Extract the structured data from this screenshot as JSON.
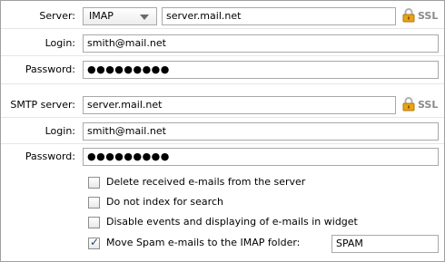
{
  "imap": {
    "server_label": "Server:",
    "protocol": "IMAP",
    "server_value": "server.mail.net",
    "ssl_label": "SSL",
    "login_label": "Login:",
    "login_value": "smith@mail.net",
    "password_label": "Password:",
    "password_value": "●●●●●●●●●"
  },
  "smtp": {
    "server_label": "SMTP server:",
    "server_value": "server.mail.net",
    "ssl_label": "SSL",
    "login_label": "Login:",
    "login_value": "smith@mail.net",
    "password_label": "Password:",
    "password_value": "●●●●●●●●●"
  },
  "options": [
    {
      "label": "Delete received e-mails from the server",
      "checked": false
    },
    {
      "label": "Do not index for search",
      "checked": false
    },
    {
      "label": "Disable events and displaying of e-mails in widget",
      "checked": false
    },
    {
      "label": "Move Spam e-mails to the IMAP folder:",
      "checked": true
    }
  ],
  "spam_folder_value": "SPAM",
  "colors": {
    "lock": "#e8a317",
    "ssl_text": "#8a8a8a",
    "check": "#2b3f73"
  },
  "icons": {
    "lock": "padlock",
    "dropdown": "chevron-down",
    "check": "checkmark"
  }
}
